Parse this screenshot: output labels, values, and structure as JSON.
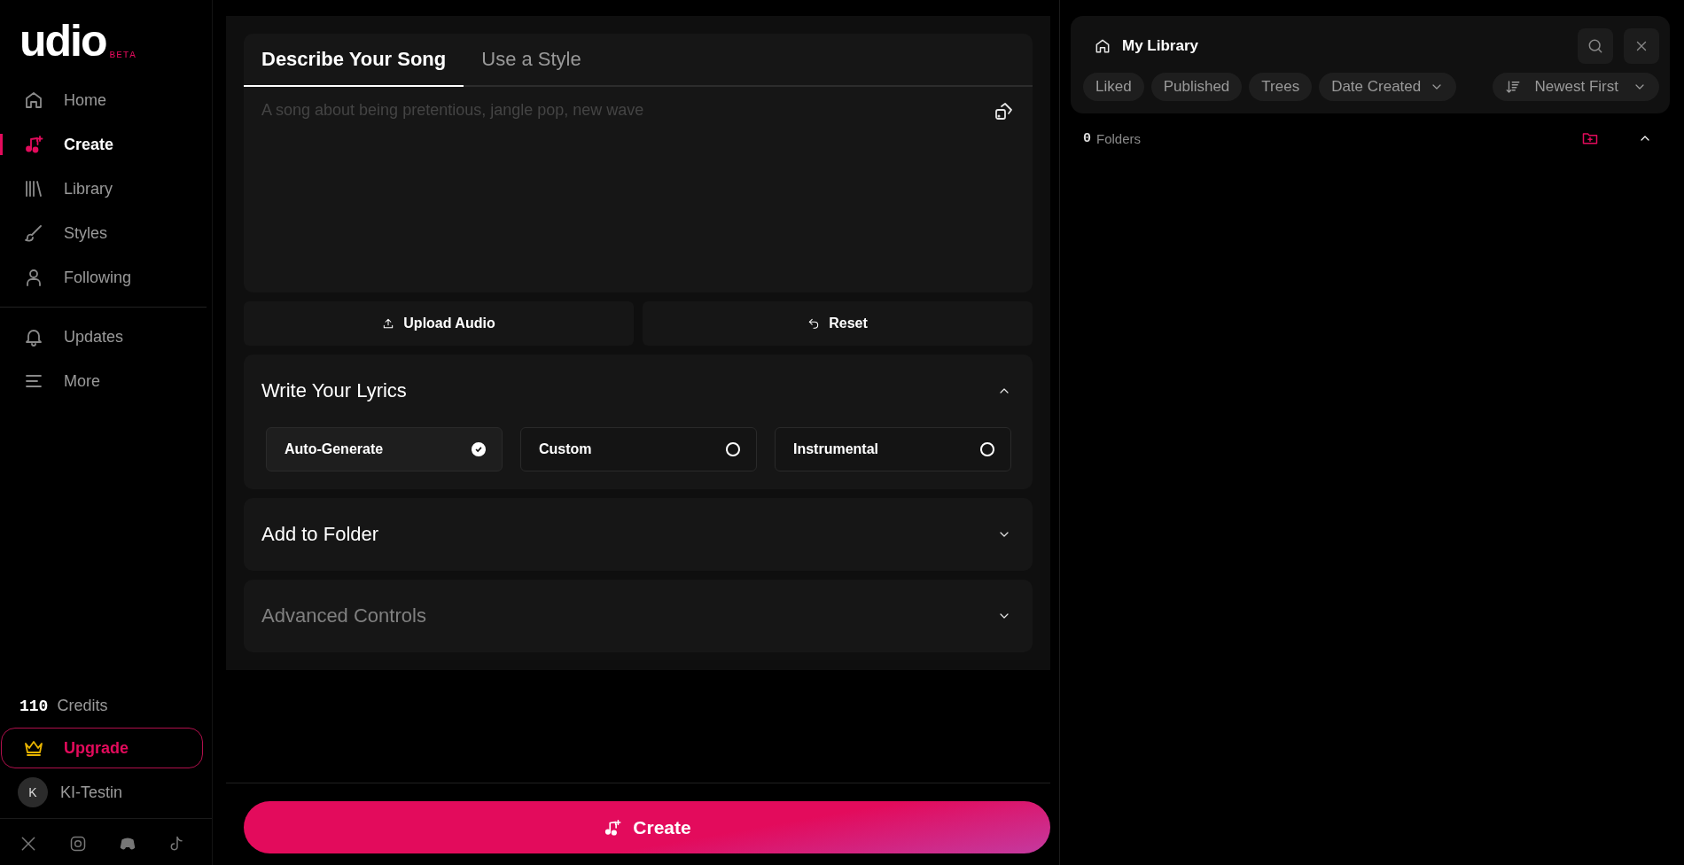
{
  "logo": {
    "wordmark": "udio",
    "badge": "BETA"
  },
  "nav_primary": [
    {
      "label": "Home",
      "selected": false
    },
    {
      "label": "Create",
      "selected": true
    },
    {
      "label": "Library",
      "selected": false
    },
    {
      "label": "Styles",
      "selected": false
    },
    {
      "label": "Following",
      "selected": false
    }
  ],
  "nav_secondary": [
    {
      "label": "Updates",
      "selected": false
    },
    {
      "label": "More",
      "selected": false
    }
  ],
  "credits": {
    "count": "110",
    "label": "Credits"
  },
  "upgrade": "Upgrade",
  "user": {
    "initial": "K",
    "name": "KI-Testin"
  },
  "prompt": {
    "tabs": [
      {
        "label": "Describe Your Song",
        "selected": true
      },
      {
        "label": "Use a Style",
        "selected": false
      }
    ],
    "placeholder": "A song about being pretentious, jangle pop, new wave"
  },
  "actions": [
    {
      "label": "Upload Audio",
      "kind": "upload"
    },
    {
      "label": "Reset",
      "kind": "reset"
    }
  ],
  "lyrics": {
    "title": "Write Your Lyrics",
    "expanded": true,
    "options": [
      {
        "label": "Auto-Generate",
        "selected": true
      },
      {
        "label": "Custom",
        "selected": false
      },
      {
        "label": "Instrumental",
        "selected": false
      }
    ]
  },
  "sections": [
    {
      "title": "Add to Folder",
      "expanded": false,
      "disabled": false
    },
    {
      "title": "Advanced Controls",
      "expanded": false,
      "disabled": true
    }
  ],
  "create_button": "Create",
  "library": {
    "title": "My Library",
    "filters": [
      {
        "label": "Liked",
        "kind": "chip"
      },
      {
        "label": "Published",
        "kind": "chip"
      },
      {
        "label": "Trees",
        "kind": "chip"
      },
      {
        "label": "Date Created",
        "kind": "dropdown"
      }
    ],
    "sort": "Newest First",
    "folders": {
      "count": "0",
      "label": "Folders",
      "expanded": true
    }
  }
}
